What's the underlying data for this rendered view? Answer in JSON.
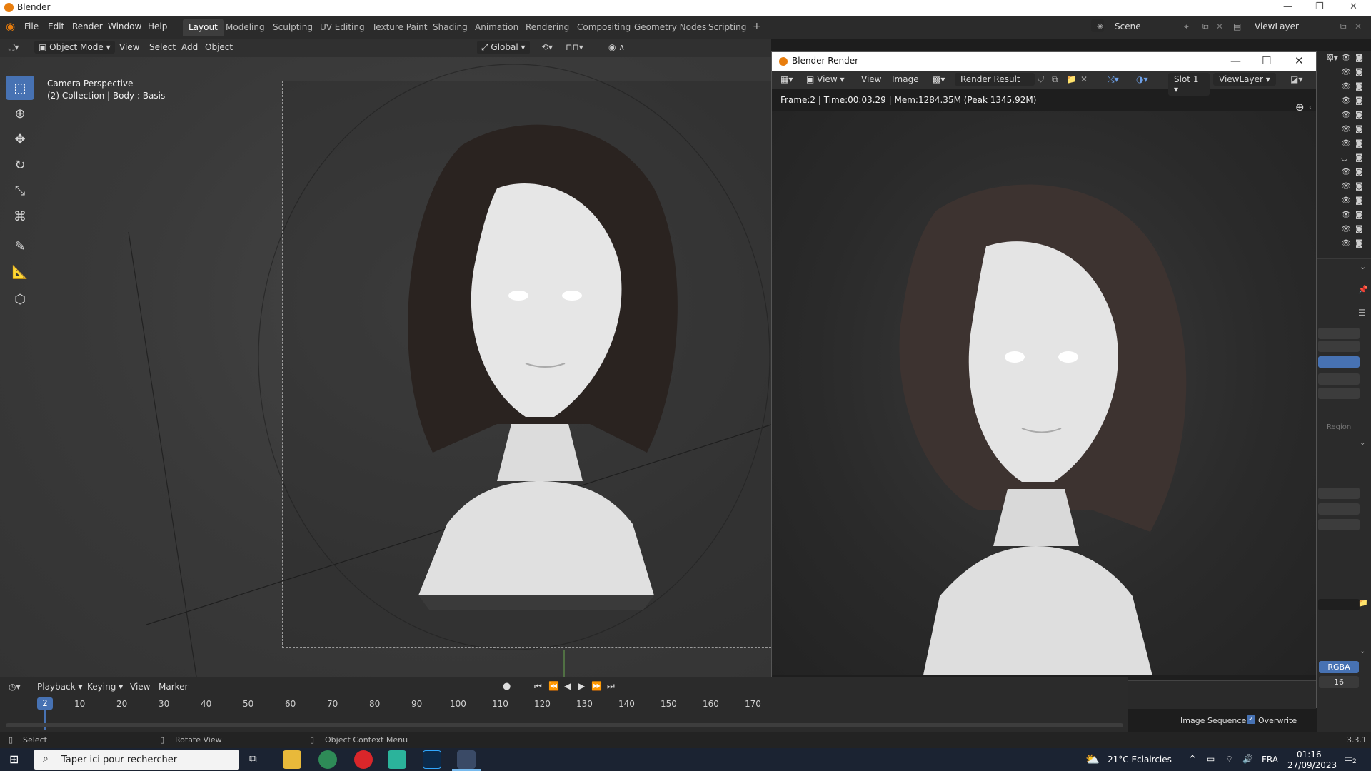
{
  "os_window": {
    "title": "Blender"
  },
  "menu": [
    "File",
    "Edit",
    "Render",
    "Window",
    "Help"
  ],
  "workspaces": {
    "tabs": [
      "Layout",
      "Modeling",
      "Sculpting",
      "UV Editing",
      "Texture Paint",
      "Shading",
      "Animation",
      "Rendering",
      "Compositing",
      "Geometry Nodes",
      "Scripting"
    ],
    "active": "Layout",
    "add": "+"
  },
  "scene": {
    "label": "Scene"
  },
  "view_layer": {
    "label": "ViewLayer"
  },
  "viewport_header": {
    "mode": "Object Mode",
    "view": "View",
    "select": "Select",
    "add": "Add",
    "object": "Object",
    "orientation": "Global"
  },
  "viewport": {
    "camera": "Camera Perspective",
    "collection": "(2) Collection | Body : Basis"
  },
  "render_window": {
    "title": "Blender Render",
    "view1": "View",
    "view2": "View",
    "image": "Image",
    "result": "Render Result",
    "slot": "Slot 1",
    "view_layer": "ViewLayer",
    "stats": "Frame:2 | Time:00:03.29 | Mem:1284.35M (Peak 1345.92M)"
  },
  "properties": {
    "region": "Region",
    "rgba": "RGBA",
    "depth": "16",
    "image_sequence": "Image Sequence",
    "overwrite": "Overwrite",
    "version": "3.3.1"
  },
  "timeline": {
    "playback": "Playback",
    "keying": "Keying",
    "view": "View",
    "marker": "Marker",
    "current_frame": "2",
    "ticks": [
      "10",
      "20",
      "30",
      "40",
      "50",
      "60",
      "70",
      "80",
      "90",
      "100",
      "110",
      "120",
      "130",
      "140",
      "150",
      "160",
      "170"
    ]
  },
  "status": {
    "select": "Select",
    "rotate": "Rotate View",
    "context": "Object Context Menu"
  },
  "taskbar": {
    "search_placeholder": "Taper ici pour rechercher",
    "weather": "21°C  Eclaircies",
    "lang": "FRA",
    "time": "01:16",
    "date": "27/09/2023",
    "notif": "2"
  },
  "colors": {
    "accent": "#4772b3",
    "blender_orange": "#e87d0d"
  }
}
